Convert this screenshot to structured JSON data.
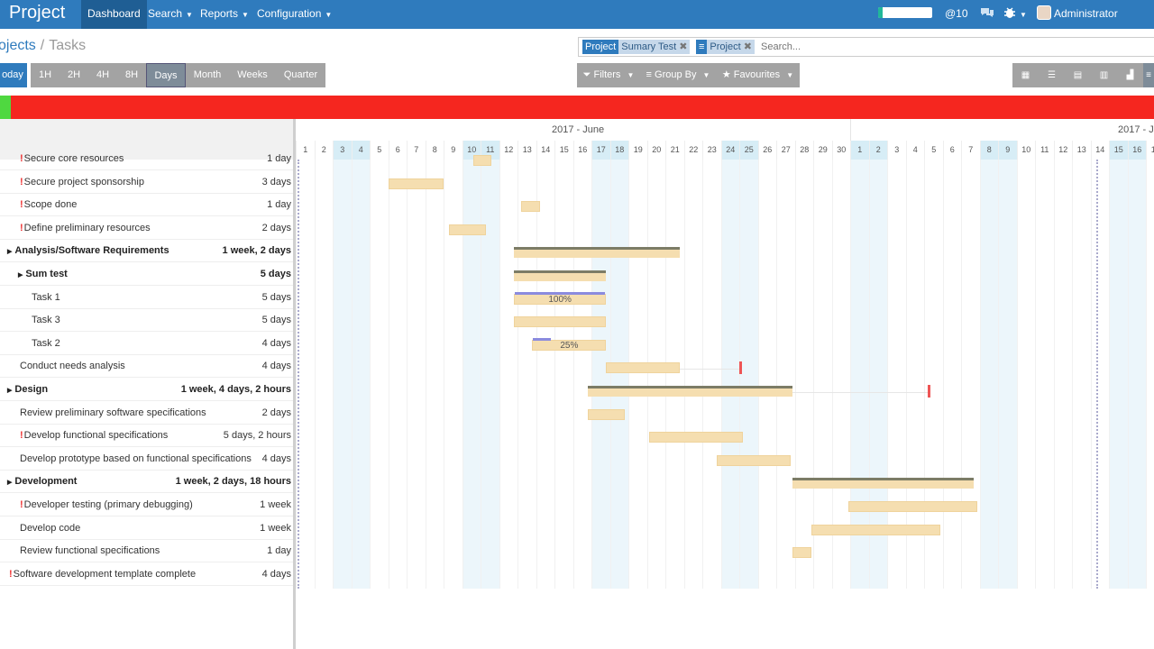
{
  "app": {
    "title": "Project"
  },
  "nav": {
    "menus": [
      {
        "label": "Dashboard",
        "active": true
      },
      {
        "label": "Search",
        "caret": true
      },
      {
        "label": "Reports",
        "caret": true
      },
      {
        "label": "Configuration",
        "caret": true
      }
    ]
  },
  "systray": {
    "mentions": "@10",
    "user": "Administrator (gantt_d"
  },
  "breadcrumb": {
    "parent": "ojects",
    "current": "Tasks"
  },
  "search": {
    "facets": [
      {
        "key": "Project",
        "value": "Sumary Test"
      },
      {
        "key": "≡",
        "value": "Project"
      }
    ],
    "placeholder": "Search..."
  },
  "scale_buttons": [
    "oday",
    "1H",
    "2H",
    "4H",
    "8H",
    "Days",
    "Month",
    "Weeks",
    "Quarter"
  ],
  "controls": {
    "filters": "Filters",
    "groupby": "Group By",
    "favourites": "Favourites"
  },
  "views": [
    "kanban-icon",
    "list-icon",
    "calendar-icon",
    "pivot-icon",
    "graph-icon",
    "gantt-icon"
  ],
  "gantt": {
    "months": [
      "2017 - June",
      "2017 - J"
    ],
    "days": [
      "1",
      "2",
      "3",
      "4",
      "5",
      "6",
      "7",
      "8",
      "9",
      "10",
      "11",
      "12",
      "13",
      "14",
      "15",
      "16",
      "17",
      "18",
      "19",
      "20",
      "21",
      "22",
      "23",
      "24",
      "25",
      "26",
      "27",
      "28",
      "29",
      "30",
      "1",
      "2",
      "3",
      "4",
      "5",
      "6",
      "7",
      "8",
      "9",
      "10",
      "11",
      "12",
      "13",
      "14",
      "15",
      "16",
      "17"
    ],
    "weekend_index": [
      2,
      3,
      9,
      10,
      16,
      17,
      23,
      24,
      30,
      31,
      37,
      38,
      44,
      45
    ]
  },
  "tasks": [
    {
      "name": "Secure core resources",
      "duration": "1 day",
      "flag": true,
      "indent": 1,
      "group": false
    },
    {
      "name": "Secure project sponsorship",
      "duration": "3 days",
      "flag": true,
      "indent": 1,
      "group": false
    },
    {
      "name": "Scope done",
      "duration": "1 day",
      "flag": true,
      "indent": 1,
      "group": false
    },
    {
      "name": "Define preliminary resources",
      "duration": "2 days",
      "flag": true,
      "indent": 1,
      "group": false
    },
    {
      "name": "Analysis/Software Requirements",
      "duration": "1 week, 2 days",
      "flag": false,
      "indent": 0,
      "group": true
    },
    {
      "name": "Sum test",
      "duration": "5 days",
      "flag": false,
      "indent": 1,
      "group": true
    },
    {
      "name": "Task 1",
      "duration": "5 days",
      "flag": false,
      "indent": 2,
      "group": false
    },
    {
      "name": "Task 3",
      "duration": "5 days",
      "flag": false,
      "indent": 2,
      "group": false
    },
    {
      "name": "Task 2",
      "duration": "4 days",
      "flag": false,
      "indent": 2,
      "group": false
    },
    {
      "name": "Conduct needs analysis",
      "duration": "4 days",
      "flag": false,
      "indent": 1,
      "group": false
    },
    {
      "name": "Design",
      "duration": "1 week, 4 days, 2 hours",
      "flag": false,
      "indent": 0,
      "group": true
    },
    {
      "name": "Review preliminary software specifications",
      "duration": "2 days",
      "flag": false,
      "indent": 1,
      "group": false
    },
    {
      "name": "Develop functional specifications",
      "duration": "5 days, 2 hours",
      "flag": true,
      "indent": 1,
      "group": false
    },
    {
      "name": "Develop prototype based on functional specifications",
      "duration": "4 days",
      "flag": false,
      "indent": 1,
      "group": false
    },
    {
      "name": "Development",
      "duration": "1 week, 2 days, 18 hours",
      "flag": false,
      "indent": 0,
      "group": true
    },
    {
      "name": "Developer testing (primary debugging)",
      "duration": "1 week",
      "flag": true,
      "indent": 1,
      "group": false
    },
    {
      "name": "Develop code",
      "duration": "1 week",
      "flag": false,
      "indent": 1,
      "group": false
    },
    {
      "name": "Review functional specifications",
      "duration": "1 day",
      "flag": false,
      "indent": 1,
      "group": false
    },
    {
      "name": "Software development template complete",
      "duration": "4 days",
      "flag": true,
      "indent": 0,
      "group": false
    }
  ],
  "bars": [
    {
      "row": 0,
      "start": 9.6,
      "days": 1,
      "type": "task"
    },
    {
      "row": 1,
      "start": 5,
      "days": 3,
      "type": "task"
    },
    {
      "row": 2,
      "start": 12.2,
      "days": 1,
      "type": "task"
    },
    {
      "row": 3,
      "start": 8.3,
      "days": 2,
      "type": "task"
    },
    {
      "row": 4,
      "start": 11.8,
      "days": 9,
      "type": "summary"
    },
    {
      "row": 5,
      "start": 11.8,
      "days": 5,
      "type": "summary"
    },
    {
      "row": 6,
      "start": 11.8,
      "days": 5,
      "type": "task",
      "label": "100%",
      "progress": 1.0
    },
    {
      "row": 7,
      "start": 11.8,
      "days": 5,
      "type": "task"
    },
    {
      "row": 8,
      "start": 12.8,
      "days": 4,
      "type": "task",
      "label": "25%",
      "progress": 0.25
    },
    {
      "row": 9,
      "start": 16.8,
      "days": 4,
      "type": "task",
      "deadline": 24
    },
    {
      "row": 10,
      "start": 15.8,
      "days": 11.1,
      "type": "summary",
      "deadline": 34.2
    },
    {
      "row": 11,
      "start": 15.8,
      "days": 2,
      "type": "task"
    },
    {
      "row": 12,
      "start": 19.1,
      "days": 5.1,
      "type": "task"
    },
    {
      "row": 13,
      "start": 22.8,
      "days": 4,
      "type": "task"
    },
    {
      "row": 14,
      "start": 26.9,
      "days": 9.8,
      "type": "summary"
    },
    {
      "row": 15,
      "start": 29.9,
      "days": 7,
      "type": "task"
    },
    {
      "row": 16,
      "start": 27.9,
      "days": 7,
      "type": "task"
    },
    {
      "row": 17,
      "start": 26.9,
      "days": 1,
      "type": "task"
    }
  ]
}
